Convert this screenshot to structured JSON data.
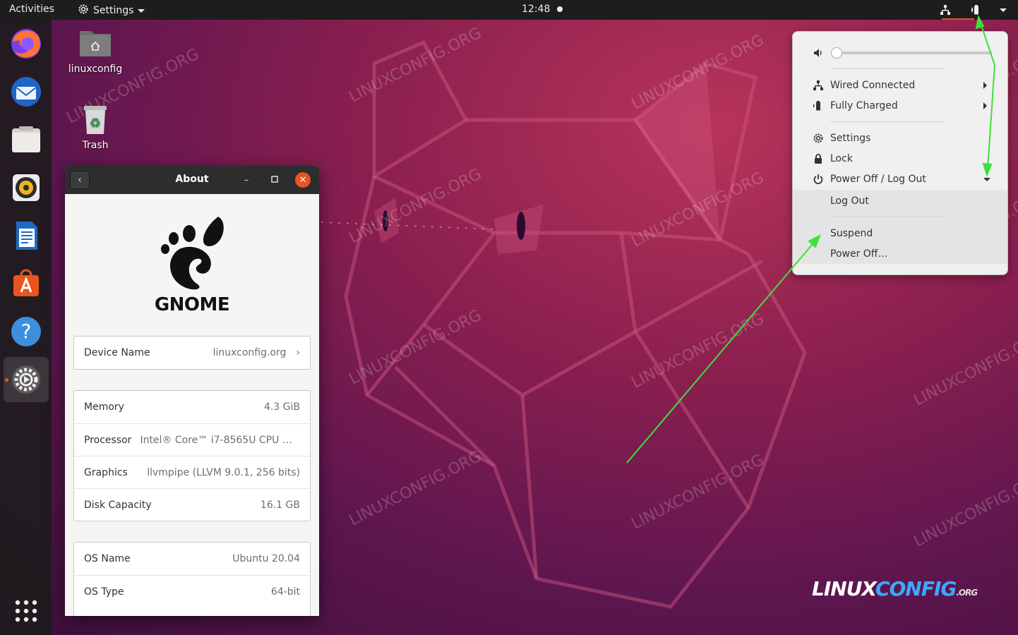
{
  "topbar": {
    "activities": "Activities",
    "app_name": "Settings",
    "clock": "12:48"
  },
  "desktop": {
    "home_label": "linuxconfig",
    "trash_label": "Trash"
  },
  "about_window": {
    "title": "About",
    "logo_text": "GNOME",
    "device": {
      "label": "Device Name",
      "value": "linuxconfig.org"
    },
    "hardware": [
      {
        "label": "Memory",
        "value": "4.3 GiB"
      },
      {
        "label": "Processor",
        "value": "Intel® Core™ i7-8565U CPU @ 1…"
      },
      {
        "label": "Graphics",
        "value": "llvmpipe (LLVM 9.0.1, 256 bits)"
      },
      {
        "label": "Disk Capacity",
        "value": "16.1 GB"
      }
    ],
    "os": [
      {
        "label": "OS Name",
        "value": "Ubuntu 20.04"
      },
      {
        "label": "OS Type",
        "value": "64-bit"
      }
    ]
  },
  "system_menu": {
    "volume": 0.0,
    "wired": "Wired Connected",
    "battery": "Fully Charged",
    "settings": "Settings",
    "lock": "Lock",
    "power": "Power Off / Log Out",
    "logout": "Log Out",
    "suspend": "Suspend",
    "poweroff": "Power Off…"
  },
  "watermark": {
    "text": "LINUXCONFIG.ORG",
    "brand_linux": "LINUX",
    "brand_config": "CONFIG",
    "brand_org": ".ORG"
  },
  "colors": {
    "accent": "#e95420",
    "arrow": "#3ee03a"
  }
}
